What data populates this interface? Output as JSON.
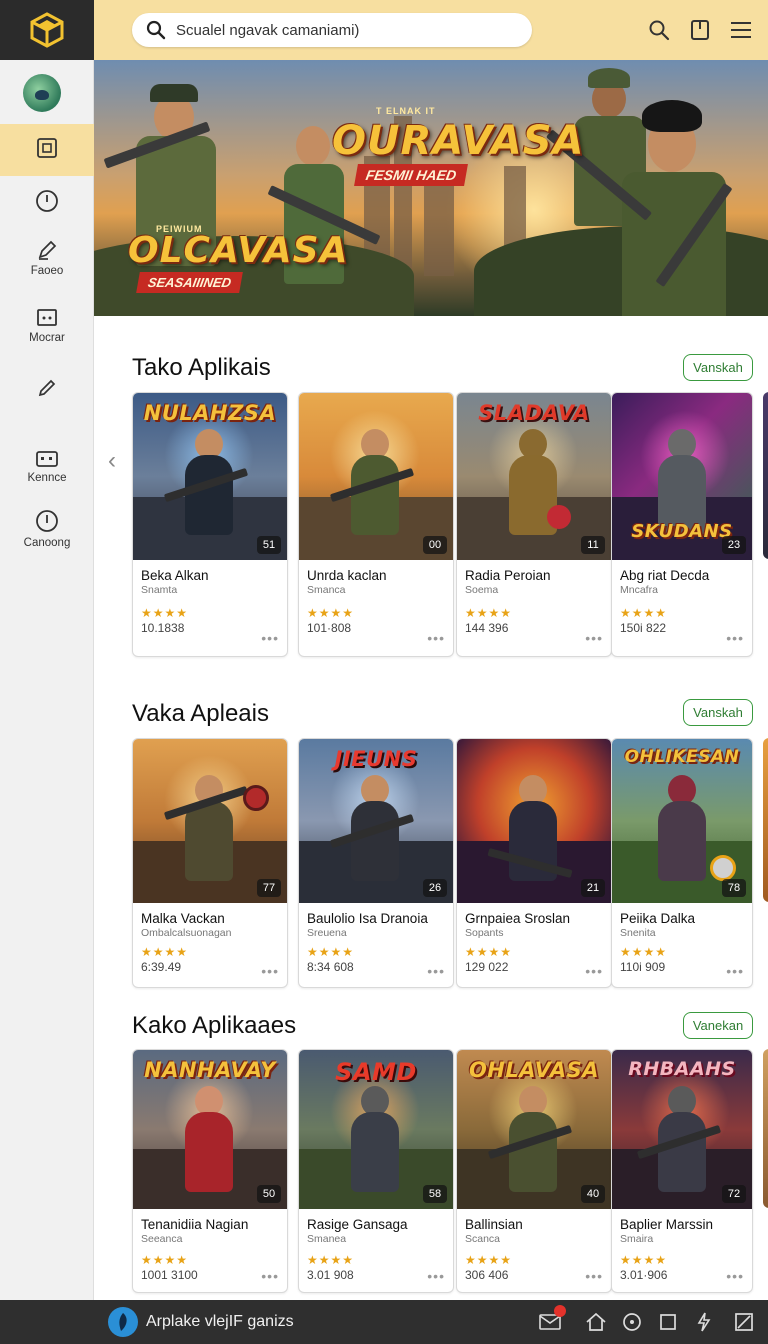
{
  "search": {
    "placeholder": "Scualel ngavak camaniami)"
  },
  "header_icons": [
    "search-icon",
    "bookmark-icon",
    "menu-icon"
  ],
  "sidebar": {
    "items": [
      {
        "icon": "square-icon",
        "label": "",
        "active": true
      },
      {
        "icon": "clock-icon",
        "label": ""
      },
      {
        "icon": "pen-icon",
        "label": "Faoeo"
      },
      {
        "icon": "image-icon",
        "label": "Mocrar"
      },
      {
        "icon": "pencil-icon",
        "label": ""
      },
      {
        "icon": "keyboard-icon",
        "label": "Kennce"
      },
      {
        "icon": "info-icon",
        "label": "Canoong"
      }
    ]
  },
  "hero": {
    "top_tag": "T ELNAK IT",
    "title_main": "OURAVASA",
    "subtitle_main": "FESMII HAED",
    "title_left_tag": "PEIWIUM",
    "title_left": "OLCAVASA",
    "subtitle_left": "SEASAIIINED"
  },
  "sections": [
    {
      "title": "Tako Aplikais",
      "see_all": "Vanskah",
      "apps": [
        {
          "title_art": "NULAHZSA",
          "badge": "51",
          "name": "Beka Alkan",
          "category": "Snamta",
          "stars": "★★★★",
          "downloads": "10.1838"
        },
        {
          "title_art": "",
          "badge": "00",
          "name": "Unrda kaclan",
          "category": "Smanca",
          "stars": "★★★★",
          "downloads": "101·808"
        },
        {
          "title_art": "SLADAVA",
          "badge": "11",
          "name": "Radia Peroian",
          "category": "Soema",
          "stars": "★★★★",
          "downloads": "144 396"
        },
        {
          "title_art": "SKUDANS",
          "badge": "23",
          "name": "Abg riat Decda",
          "category": "Mncafra",
          "stars": "★★★★",
          "downloads": "150i 822"
        }
      ]
    },
    {
      "title": "Vaka Apleais",
      "see_all": "Vanskah",
      "apps": [
        {
          "title_art": "",
          "badge": "77",
          "name": "Malka Vackan",
          "category": "Ombalcalsuonagan",
          "stars": "★★★★",
          "downloads": "6:39.49"
        },
        {
          "title_art": "JIEUNS",
          "badge": "26",
          "name": "Baulolio Isa Dranoia",
          "category": "Sreuena",
          "stars": "★★★★",
          "downloads": "8:34 608"
        },
        {
          "title_art": "",
          "badge": "21",
          "name": "Grnpaiea Sroslan",
          "category": "Sopants",
          "stars": "★★★★",
          "downloads": "129 022"
        },
        {
          "title_art": "OHLIKESAN",
          "badge": "78",
          "name": "Peiika Dalka",
          "category": "Snenita",
          "stars": "★★★★",
          "downloads": "110i 909"
        }
      ]
    },
    {
      "title": "Kako Aplikaaes",
      "see_all": "Vanekan",
      "apps": [
        {
          "title_art": "NANHAVAY",
          "badge": "50",
          "name": "Tenanidiia Nagian",
          "category": "Seeanca",
          "stars": "★★★★",
          "downloads": "1001 3100"
        },
        {
          "title_art": "SAMD",
          "badge": "58",
          "name": "Rasige Gansaga",
          "category": "Smanea",
          "stars": "★★★★",
          "downloads": "3.01 908"
        },
        {
          "title_art": "OHLAVASA",
          "badge": "40",
          "name": "Ballinsian",
          "category": "Scanca",
          "stars": "★★★★",
          "downloads": "306 406"
        },
        {
          "title_art": "RHBAAHS",
          "badge": "72",
          "name": "Baplier Marssin",
          "category": "Smaira",
          "stars": "★★★★",
          "downloads": "3.01·906"
        }
      ]
    }
  ],
  "taskbar": {
    "app_label": "Arplake vlejIF ganizs",
    "icons": [
      "mail-icon",
      "home-icon",
      "circle-icon",
      "square-icon",
      "bolt-icon",
      "window-icon"
    ]
  },
  "colors": {
    "topbar": "#f7dfa0",
    "sidebar": "#f1f1f1",
    "accent_green": "#3a9a3f",
    "star": "#e8a317",
    "taskbar": "#2f2f2f"
  }
}
